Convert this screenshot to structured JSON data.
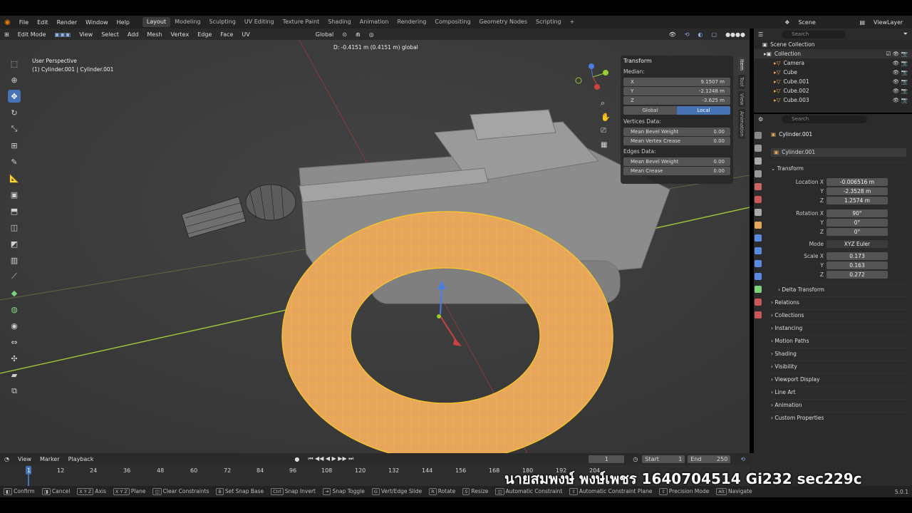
{
  "menus": [
    "File",
    "Edit",
    "Render",
    "Window",
    "Help"
  ],
  "workspaces": [
    "Layout",
    "Modeling",
    "Sculpting",
    "UV Editing",
    "Texture Paint",
    "Shading",
    "Animation",
    "Rendering",
    "Compositing",
    "Geometry Nodes",
    "Scripting"
  ],
  "active_workspace": "Layout",
  "scene": "Scene",
  "view_layer": "ViewLayer",
  "header3d": {
    "mode": "Edit Mode",
    "menus": [
      "View",
      "Select",
      "Add",
      "Mesh",
      "Vertex",
      "Edge",
      "Face",
      "UV"
    ],
    "orientation": "Global"
  },
  "viewport": {
    "perspective": "User Perspective",
    "object": "(1) Cylinder.001 | Cylinder.001",
    "status": "D: -0.4151 m (0.4151 m) global"
  },
  "npanel": {
    "title": "Transform",
    "median_label": "Median:",
    "x_label": "X",
    "x": "9.1507 m",
    "y_label": "Y",
    "y": "-2.1248 m",
    "z_label": "Z",
    "z": "-3.625 m",
    "global": "Global",
    "local": "Local",
    "vertices_data": "Vertices Data:",
    "mean_bevel_weight": "Mean Bevel Weight",
    "mbw_value": "0.00",
    "mean_vertex_crease": "Mean Vertex Crease",
    "mvc_value": "0.00",
    "edges_data": "Edges Data:",
    "edge_mbw": "Mean Bevel Weight",
    "edge_mbw_value": "0.00",
    "mean_crease": "Mean Crease",
    "mc_value": "0.00"
  },
  "side_tabs": [
    "Item",
    "Tool",
    "View",
    "Animation"
  ],
  "outliner": {
    "search_placeholder": "Search",
    "scene_collection": "Scene Collection",
    "collection": "Collection",
    "items": [
      "Camera",
      "Cube",
      "Cube.001",
      "Cube.002",
      "Cube.003"
    ]
  },
  "properties": {
    "search_placeholder": "Search",
    "object": "Cylinder.001",
    "data_name": "Cylinder.001",
    "transform": "Transform",
    "location_label": "Location X",
    "loc_x": "-0.006516 m",
    "y_label": "Y",
    "loc_y": "-2.3528 m",
    "z_label": "Z",
    "loc_z": "1.2574 m",
    "rotation_label": "Rotation X",
    "rot_x": "90°",
    "rot_y": "0°",
    "rot_z": "0°",
    "mode_label": "Mode",
    "mode": "XYZ Euler",
    "scale_label": "Scale X",
    "scale_x": "0.173",
    "scale_y": "0.163",
    "scale_z": "0.272",
    "delta": "Delta Transform",
    "sections": [
      "Relations",
      "Collections",
      "Instancing",
      "Motion Paths",
      "Shading",
      "Visibility",
      "Viewport Display",
      "Line Art",
      "Animation",
      "Custom Properties"
    ]
  },
  "timeline": {
    "menus": [
      "View",
      "Marker",
      "Playback"
    ],
    "current": "1",
    "start_label": "Start",
    "start": "1",
    "end_label": "End",
    "end": "250",
    "ticks": [
      "1",
      "12",
      "24",
      "36",
      "48",
      "60",
      "72",
      "84",
      "96",
      "108",
      "120",
      "132",
      "144",
      "156",
      "168",
      "180",
      "192",
      "204"
    ]
  },
  "statusbar": {
    "items": [
      [
        "",
        "Confirm"
      ],
      [
        "",
        "Cancel"
      ],
      [
        "X Y Z",
        "Axis"
      ],
      [
        "X Y Z",
        "Plane"
      ],
      [
        "",
        "Clear Constraints"
      ],
      [
        "B",
        "Set Snap Base"
      ],
      [
        "Ctrl",
        "Snap Invert"
      ],
      [
        "",
        "Snap Toggle"
      ],
      [
        "G",
        "Vert/Edge Slide"
      ],
      [
        "R",
        "Rotate"
      ],
      [
        "S",
        "Resize"
      ],
      [
        "",
        "Automatic Constraint"
      ],
      [
        "",
        "Automatic Constraint Plane"
      ],
      [
        "",
        "Precision Mode"
      ],
      [
        "Alt",
        "Navigate"
      ]
    ],
    "version": "5.0.1"
  },
  "overlay_text": "นายสมพงษ์ พงษ์เพชร 1640704514 Gi232 sec229c",
  "colors": {
    "accent": "#4772b3",
    "torus": "#e8a65c",
    "wire": "#f2c230",
    "xaxis": "#d04040",
    "yaxis": "#9acd32"
  }
}
